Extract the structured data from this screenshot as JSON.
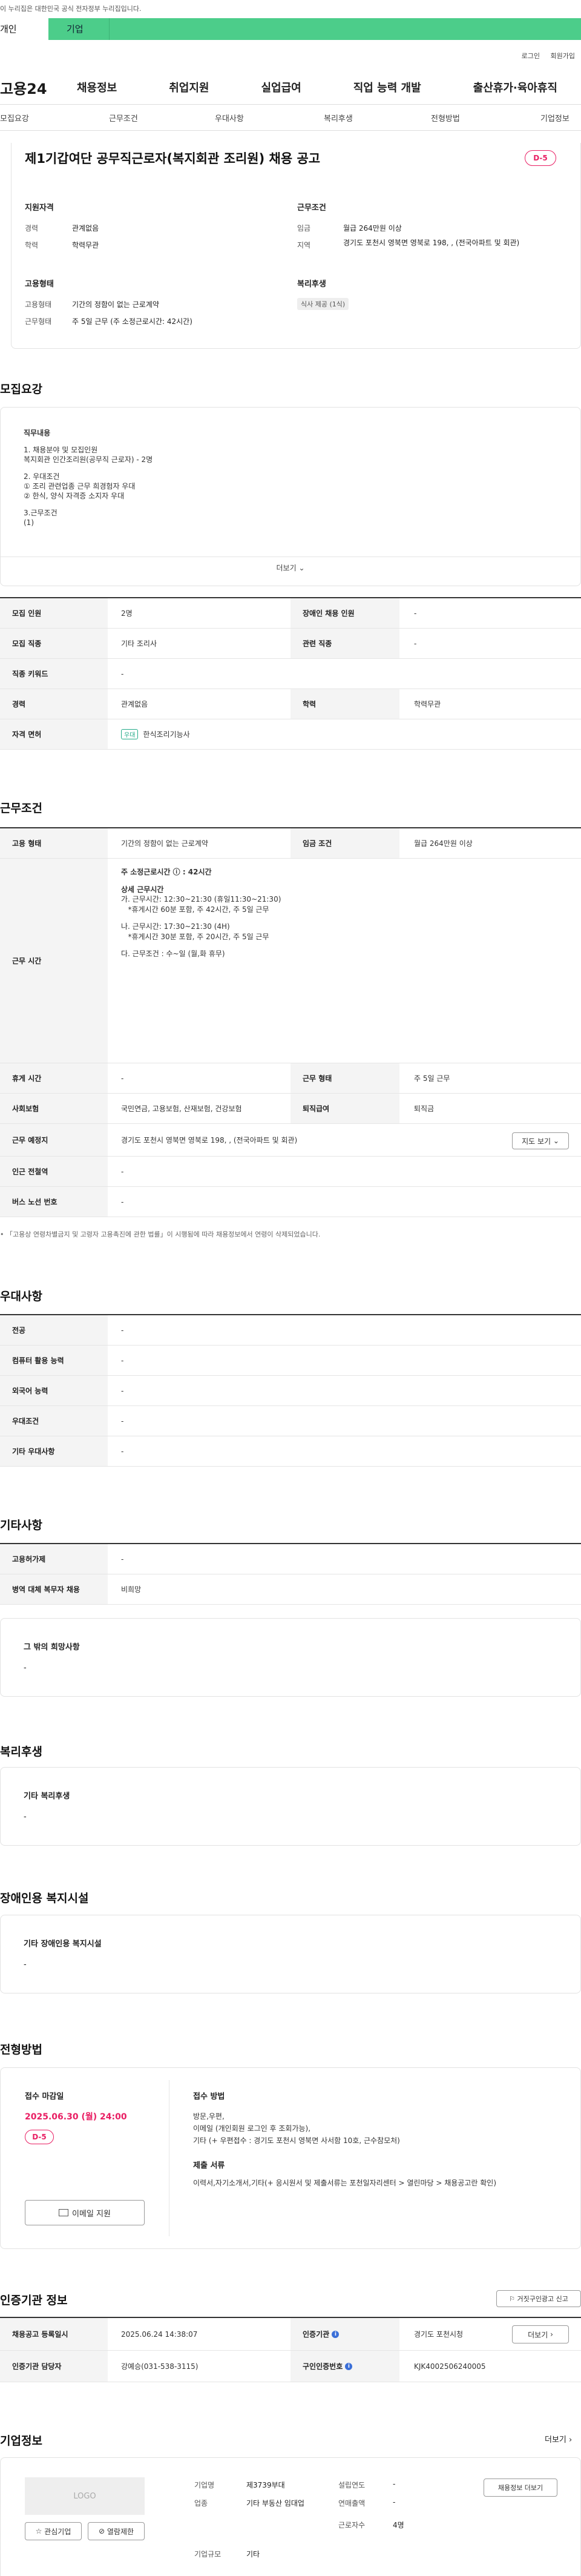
{
  "gov_banner": "이 누리집은 대한민국 공식 전자정부 누리집입니다.",
  "tabs": {
    "personal": "개인",
    "company": "기업"
  },
  "util": {
    "login": "로그인",
    "join": "회원가입"
  },
  "gnb": {
    "logo": "고용24",
    "menu": [
      "채용정보",
      "취업지원",
      "실업급여",
      "직업 능력 개발",
      "출산휴가·육아휴직"
    ]
  },
  "subtabs": [
    "모집요강",
    "근무조건",
    "우대사항",
    "복리후생",
    "전형방법",
    "기업정보"
  ],
  "header": {
    "title": "제1기갑여단 공무직근로자(복지회관 조리원) 채용 공고",
    "dday": "D-5",
    "qual_title": "지원자격",
    "career_label": "경력",
    "career": "관계없음",
    "edu_label": "학력",
    "edu": "학력무관",
    "cond_title": "근무조건",
    "wage_label": "임금",
    "wage": "월급 264만원 이상",
    "region_label": "지역",
    "region": "경기도 포천시 영북면 영북로 198, , (전국아파트 및 회관)",
    "emp_title": "고용형태",
    "emp_type_label": "고용형태",
    "emp_type": "기간의 정함이 없는 근로계약",
    "work_type_label": "근무형태",
    "work_type": "주 5일 근무 (주 소정근로시간: 42시간)",
    "welfare_title": "복리후생",
    "welfare_badge": "식사 제공 (1식)"
  },
  "recruit": {
    "title": "모집요강",
    "lines": [
      "직무내용",
      "",
      "1. 채용분야 및 모집인원",
      "복지회관 인간조리원(공무직 근로자) - 2명",
      "",
      "2. 우대조건",
      "① 조리 관련업종 근무 희경험자 우대",
      "② 한식, 양식 자격증 소지자 우대",
      "",
      "3.근무조건",
      "(1)"
    ],
    "more": "더보기",
    "rows": {
      "count_label": "모집 인원",
      "count": "2명",
      "disabled_label": "장애인 채용 인원",
      "disabled": "-",
      "job_label": "모집 직종",
      "job": "기타 조리사",
      "rel_label": "관련 직종",
      "rel": "-",
      "kw_label": "직종 키워드",
      "kw": "-",
      "career_label": "경력",
      "career": "관계없음",
      "edu_label": "학력",
      "edu": "학력무관",
      "license_label": "자격 면허",
      "license_tag": "우대",
      "license": "한식조리기능사"
    }
  },
  "workcond": {
    "title": "근무조건",
    "emp_label": "고용 형태",
    "emp": "기간의 정함이 없는 근로계약",
    "wage_label": "임금 조건",
    "wage": "월급 264만원 이상",
    "time_label": "근무 시간",
    "time_lines": [
      "주 소정근로시간 ⓘ : 42시간",
      "",
      "상세 근무시간",
      "가. 근무시간: 12:30~21:30 (휴일11:30~21:30)",
      "   *휴게시간 60분 포함, 주 42시간, 주 5일 근무",
      "",
      "나. 근무시간: 17:30~21:30 (4H)",
      "   *휴게시간 30분 포함, 주 20시간, 주 5일 근무",
      "",
      "다. 근무조건 : 수~일 (월,화 휴무)"
    ],
    "rest_label": "휴게 시간",
    "rest": "-",
    "worktype_label": "근무 형태",
    "worktype": "주 5일 근무",
    "insurance_label": "사회보험",
    "insurance": "국민연금, 고용보험, 산재보험, 건강보험",
    "severance_label": "퇴직급여",
    "severance": "퇴직금",
    "place_label": "근무 예정지",
    "place": "경기도 포천시 영북면 영북로 198, , (전국아파트 및 회관)",
    "map_btn": "지도 보기",
    "subway_label": "인근 전철역",
    "subway": "-",
    "bus_label": "버스 노선 번호",
    "bus": "-",
    "note": "「고용상 연령차별금지 및 고령자 고용촉진에 관한 법률」이 시행됨에 따라 채용정보에서 연령이 삭제되었습니다."
  },
  "pref": {
    "title": "우대사항",
    "rows": [
      {
        "label": "전공",
        "value": "-"
      },
      {
        "label": "컴퓨터 활용 능력",
        "value": "-"
      },
      {
        "label": "외국어 능력",
        "value": "-"
      },
      {
        "label": "우대조건",
        "value": "-"
      },
      {
        "label": "기타 우대사항",
        "value": "-"
      }
    ]
  },
  "etc": {
    "title": "기타사항",
    "rows": [
      {
        "label": "고용허가제",
        "value": "-"
      },
      {
        "label": "병역 대체 복무자 채용",
        "value": "비희망"
      }
    ],
    "other_title": "그 밖의 희망사항",
    "other": "-"
  },
  "welfare": {
    "title": "복리후생",
    "box_title": "기타 복리후생",
    "box": "-"
  },
  "disabled": {
    "title": "장애인용 복지시설",
    "box_title": "기타 장애인용 복지시설",
    "box": "-"
  },
  "process": {
    "title": "전형방법",
    "deadline_label": "접수 마감일",
    "deadline": "2025.06.30 (월) 24:00",
    "dday": "D-5",
    "email_btn": "이메일 지원",
    "method_title": "접수 방법",
    "method_lines": [
      "방문,우편,",
      "이메일 (개인회원 로그인 후 조회가능),",
      "기타 (+ 우편접수 : 경기도 포천시 영북면 사서함 10호, 근수참모처)"
    ],
    "docs_title": "제출 서류",
    "docs": "이력서,자기소개서,기타(+ 응시원서 및 제출서류는 포천일자리센터 > 열린마당 > 채용공고란 확인)"
  },
  "agency": {
    "title": "인증기관 정보",
    "report_btn": "거짓구인광고 신고",
    "reg_label": "채용공고 등록일시",
    "reg": "2025.06.24 14:38:07",
    "agency_label": "인증기관",
    "agency": "경기도 포천시청",
    "more_btn": "더보기",
    "manager_label": "인증기관 담당자",
    "manager": "강예승(031-538-3115)",
    "num_label": "구인인증번호",
    "num": "KJK4002506240005"
  },
  "company": {
    "title": "기업정보",
    "more": "더보기",
    "logo": "LOGO",
    "fav_btn": "관심기업",
    "block_btn": "열람제한",
    "name_label": "기업명",
    "name": "제3739부대",
    "year_label": "설립연도",
    "year": "-",
    "industry_label": "업종",
    "industry": "기타 부동산 임대업",
    "sales_label": "연매출액",
    "sales": "-",
    "staff_label": "근로자수",
    "staff": "4명",
    "size_label": "기업규모",
    "size": "기타",
    "jobs_btn": "채용정보 더보기"
  }
}
